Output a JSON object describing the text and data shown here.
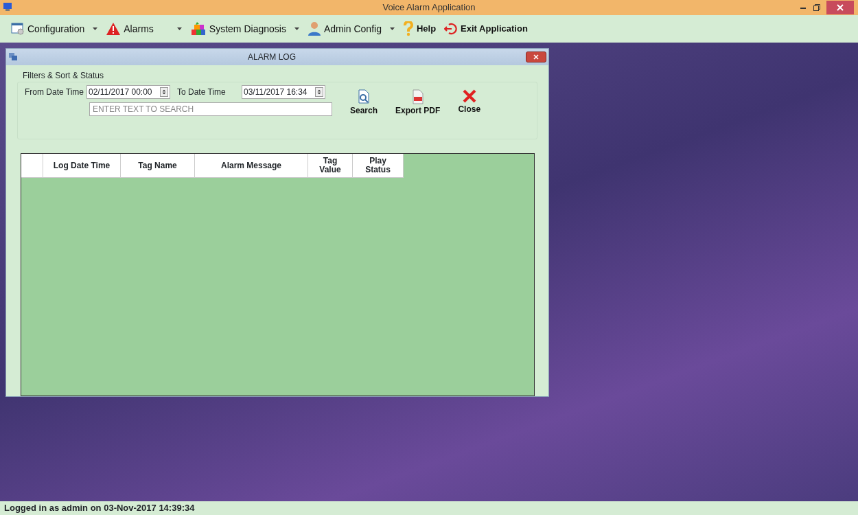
{
  "window": {
    "title": "Voice Alarm Application"
  },
  "menu": [
    {
      "label": "Configuration",
      "kind": "config",
      "dropdown": true,
      "bold": false
    },
    {
      "label": "Alarms",
      "kind": "alarm",
      "dropdown": true,
      "bold": false
    },
    {
      "label": "System Diagnosis",
      "kind": "diagnosis",
      "dropdown": true,
      "bold": false
    },
    {
      "label": "Admin Config",
      "kind": "admin",
      "dropdown": true,
      "bold": false
    },
    {
      "label": "Help",
      "kind": "help",
      "dropdown": false,
      "bold": true
    },
    {
      "label": "Exit Application",
      "kind": "exit",
      "dropdown": false,
      "bold": true
    }
  ],
  "alarm_log": {
    "title": "ALARM LOG",
    "group_title": "Filters & Sort & Status",
    "from_label": "From Date Time",
    "from_value": "02/11/2017 00:00",
    "to_label": "To Date Time",
    "to_value": "03/11/2017 16:34",
    "search": {
      "placeholder": "ENTER TEXT TO SEARCH"
    },
    "buttons": [
      {
        "label": "Search",
        "kind": "search"
      },
      {
        "label": "Export PDF",
        "kind": "pdf"
      },
      {
        "label": "Close",
        "kind": "close"
      }
    ],
    "table": {
      "columns": [
        "Log Date Time",
        "Tag Name",
        "Alarm Message",
        "Tag Value",
        "Play Status"
      ]
    }
  },
  "status_bar": "Logged in as admin on 03-Nov-2017 14:39:34"
}
